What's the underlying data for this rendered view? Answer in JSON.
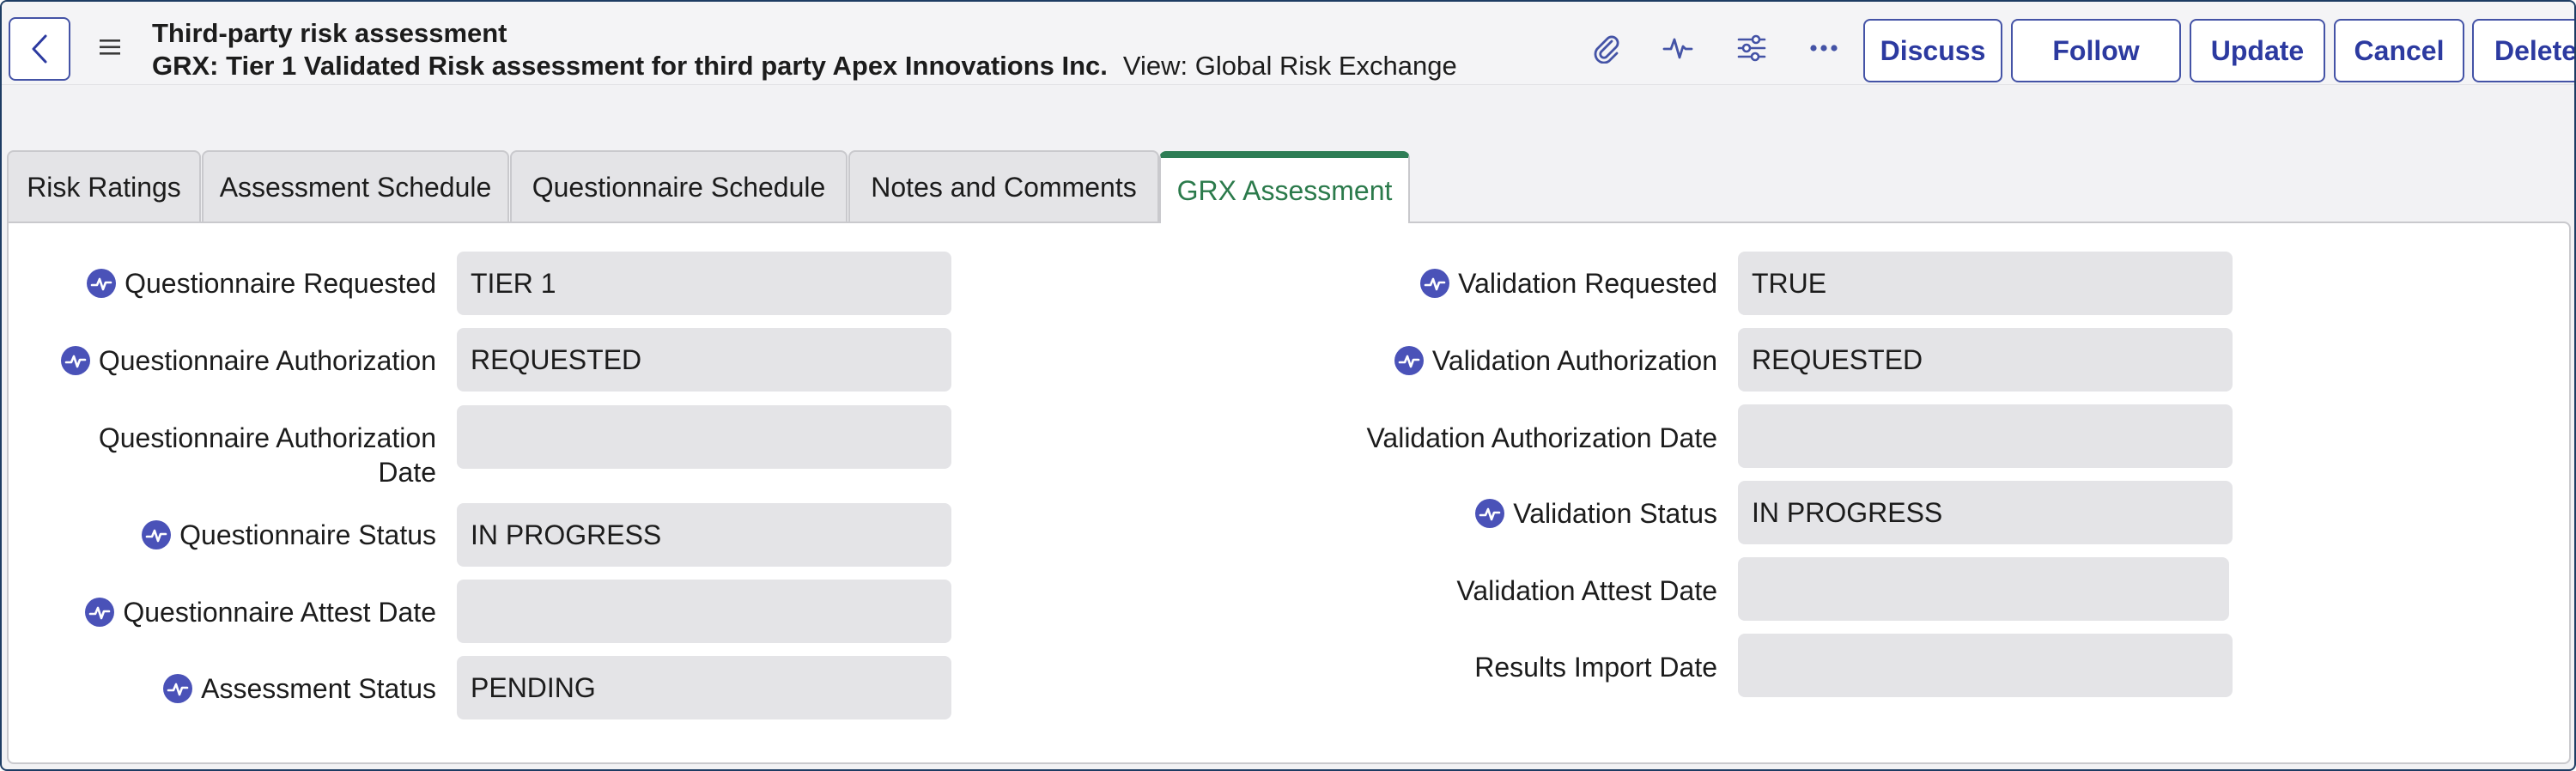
{
  "header": {
    "title": "Third-party risk assessment",
    "subtitle_bold": "GRX: Tier 1 Validated Risk assessment for third party Apex Innovations Inc.",
    "view_text": "View: Global Risk Exchange",
    "icons": [
      "attachment-icon",
      "activity-icon",
      "settings-sliders-icon",
      "more-options-icon"
    ],
    "buttons": {
      "discuss": "Discuss",
      "follow": "Follow",
      "update": "Update",
      "cancel": "Cancel",
      "delete": "Delete"
    }
  },
  "tabs": [
    {
      "label": "Risk Ratings"
    },
    {
      "label": "Assessment Schedule"
    },
    {
      "label": "Questionnaire Schedule"
    },
    {
      "label": "Notes and Comments"
    },
    {
      "label": "GRX Assessment",
      "active": true
    }
  ],
  "left_fields": [
    {
      "label": "Questionnaire Requested",
      "value": "TIER 1",
      "badge": true
    },
    {
      "label": "Questionnaire Authorization",
      "value": "REQUESTED",
      "badge": true
    },
    {
      "label": "Questionnaire Authorization Date",
      "value": "",
      "badge": false
    },
    {
      "label": "Questionnaire Status",
      "value": "IN PROGRESS",
      "badge": true
    },
    {
      "label": "Questionnaire Attest Date",
      "value": "",
      "badge": true
    },
    {
      "label": "Assessment Status",
      "value": "PENDING",
      "badge": true
    }
  ],
  "right_fields": [
    {
      "label": "Validation Requested",
      "value": "TRUE",
      "badge": true
    },
    {
      "label": "Validation Authorization",
      "value": "REQUESTED",
      "badge": true
    },
    {
      "label": "Validation Authorization Date",
      "value": "",
      "badge": false
    },
    {
      "label": "Validation Status",
      "value": "IN PROGRESS",
      "badge": true
    },
    {
      "label": "Validation Attest Date",
      "value": "",
      "badge": false
    },
    {
      "label": "Results Import Date",
      "value": "",
      "badge": false
    }
  ],
  "colors": {
    "accent": "#4453a6",
    "active_tab": "#2e7d55",
    "badge": "#4a52b8",
    "field_bg": "#e4e4e7"
  }
}
